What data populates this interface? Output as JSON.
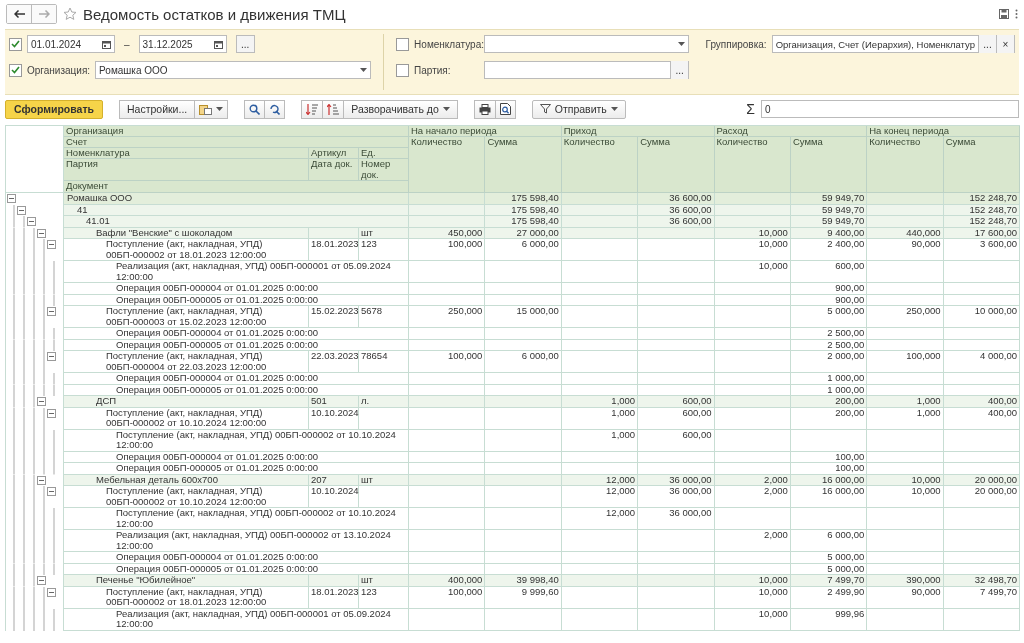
{
  "window": {
    "title": "Ведомость остатков и движения ТМЦ"
  },
  "filters": {
    "period": {
      "checked": true,
      "from": "01.01.2024",
      "separator": "–",
      "to": "31.12.2025",
      "more": "..."
    },
    "organization": {
      "checked": true,
      "label": "Организация:",
      "value": "Ромашка ООО"
    },
    "nomenclature": {
      "checked": false,
      "label": "Номенклатура:"
    },
    "batch": {
      "checked": false,
      "label": "Партия:",
      "more": "..."
    },
    "grouping": {
      "label": "Группировка:",
      "value": "Организация, Счет (Иерархия), Номенклатур",
      "more": "...",
      "clear": "×"
    }
  },
  "toolbar": {
    "generate": "Сформировать",
    "settings": "Настройки...",
    "expand": "Разворачивать до",
    "send": "Отправить",
    "sum_sign": "Σ",
    "sum_value": "0"
  },
  "table": {
    "dimension_headers": {
      "organization": "Организация",
      "account": "Счет",
      "nomenclature": "Номенклатура",
      "article": "Артикул",
      "unit": "Ед.",
      "batch": "Партия",
      "doc_date": "Дата док.",
      "doc_number": "Номер док.",
      "document": "Документ"
    },
    "groups": [
      {
        "title": "На начало периода",
        "columns": [
          "Количество",
          "Сумма"
        ]
      },
      {
        "title": "Приход",
        "columns": [
          "Количество",
          "Сумма"
        ]
      },
      {
        "title": "Расход",
        "columns": [
          "Количество",
          "Сумма"
        ]
      },
      {
        "title": "На конец периода",
        "columns": [
          "Количество",
          "Сумма"
        ]
      }
    ],
    "rows": [
      {
        "kind": "organization",
        "name": "Ромашка ООО",
        "expanded": true,
        "values": {
          "start_sum": "175 598,40",
          "in_sum": "36 600,00",
          "out_sum": "59 949,70",
          "end_sum": "152 248,70"
        },
        "children": [
          {
            "kind": "account",
            "name": "41",
            "expanded": true,
            "values": {
              "start_sum": "175 598,40",
              "in_sum": "36 600,00",
              "out_sum": "59 949,70",
              "end_sum": "152 248,70"
            },
            "children": [
              {
                "kind": "account",
                "name": "41.01",
                "expanded": true,
                "values": {
                  "start_sum": "175 598,40",
                  "in_sum": "36 600,00",
                  "out_sum": "59 949,70",
                  "end_sum": "152 248,70"
                },
                "children": [
                  {
                    "kind": "item",
                    "name": "Вафли \"Венские\" с шоколадом",
                    "unit": "шт",
                    "expanded": true,
                    "values": {
                      "start_qty": "450,000",
                      "start_sum": "27 000,00",
                      "out_qty": "10,000",
                      "out_sum": "9 400,00",
                      "end_qty": "440,000",
                      "end_sum": "17 600,00"
                    },
                    "children": [
                      {
                        "kind": "batch",
                        "name": "Поступление (акт, накладная, УПД) 00БП-000002 от 18.01.2023 12:00:00",
                        "doc_date": "18.01.2023",
                        "doc_number": "123",
                        "expanded": true,
                        "values": {
                          "start_qty": "100,000",
                          "start_sum": "6 000,00",
                          "out_qty": "10,000",
                          "out_sum": "2 400,00",
                          "end_qty": "90,000",
                          "end_sum": "3 600,00"
                        },
                        "children": [
                          {
                            "kind": "document",
                            "name": "Реализация (акт, накладная, УПД) 00БП-000001 от 05.09.2024 12:00:00",
                            "values": {
                              "out_qty": "10,000",
                              "out_sum": "600,00"
                            }
                          },
                          {
                            "kind": "document",
                            "name": "Операция 00БП-000004 от 01.01.2025 0:00:00",
                            "values": {
                              "out_sum": "900,00"
                            }
                          },
                          {
                            "kind": "document",
                            "name": "Операция 00БП-000005 от 01.01.2025 0:00:00",
                            "values": {
                              "out_sum": "900,00"
                            }
                          }
                        ]
                      },
                      {
                        "kind": "batch",
                        "name": "Поступление (акт, накладная, УПД) 00БП-000003 от 15.02.2023 12:00:00",
                        "doc_date": "15.02.2023",
                        "doc_number": "5678",
                        "expanded": true,
                        "values": {
                          "start_qty": "250,000",
                          "start_sum": "15 000,00",
                          "out_sum": "5 000,00",
                          "end_qty": "250,000",
                          "end_sum": "10 000,00"
                        },
                        "children": [
                          {
                            "kind": "document",
                            "name": "Операция 00БП-000004 от 01.01.2025 0:00:00",
                            "values": {
                              "out_sum": "2 500,00"
                            }
                          },
                          {
                            "kind": "document",
                            "name": "Операция 00БП-000005 от 01.01.2025 0:00:00",
                            "values": {
                              "out_sum": "2 500,00"
                            }
                          }
                        ]
                      },
                      {
                        "kind": "batch",
                        "name": "Поступление (акт, накладная, УПД) 00БП-000004 от 22.03.2023 12:00:00",
                        "doc_date": "22.03.2023",
                        "doc_number": "78654",
                        "expanded": true,
                        "values": {
                          "start_qty": "100,000",
                          "start_sum": "6 000,00",
                          "out_sum": "2 000,00",
                          "end_qty": "100,000",
                          "end_sum": "4 000,00"
                        },
                        "children": [
                          {
                            "kind": "document",
                            "name": "Операция 00БП-000004 от 01.01.2025 0:00:00",
                            "values": {
                              "out_sum": "1 000,00"
                            }
                          },
                          {
                            "kind": "document",
                            "name": "Операция 00БП-000005 от 01.01.2025 0:00:00",
                            "values": {
                              "out_sum": "1 000,00"
                            }
                          }
                        ]
                      }
                    ]
                  },
                  {
                    "kind": "item",
                    "name": "ДСП",
                    "article": "501",
                    "unit": "л.",
                    "expanded": true,
                    "values": {
                      "in_qty": "1,000",
                      "in_sum": "600,00",
                      "out_sum": "200,00",
                      "end_qty": "1,000",
                      "end_sum": "400,00"
                    },
                    "children": [
                      {
                        "kind": "batch",
                        "name": "Поступление (акт, накладная, УПД) 00БП-000002 от 10.10.2024 12:00:00",
                        "doc_date": "10.10.2024",
                        "expanded": true,
                        "values": {
                          "in_qty": "1,000",
                          "in_sum": "600,00",
                          "out_sum": "200,00",
                          "end_qty": "1,000",
                          "end_sum": "400,00"
                        },
                        "children": [
                          {
                            "kind": "document",
                            "name": "Поступление (акт, накладная, УПД) 00БП-000002 от 10.10.2024 12:00:00",
                            "values": {
                              "in_qty": "1,000",
                              "in_sum": "600,00"
                            }
                          },
                          {
                            "kind": "document",
                            "name": "Операция 00БП-000004 от 01.01.2025 0:00:00",
                            "values": {
                              "out_sum": "100,00"
                            }
                          },
                          {
                            "kind": "document",
                            "name": "Операция 00БП-000005 от 01.01.2025 0:00:00",
                            "values": {
                              "out_sum": "100,00"
                            }
                          }
                        ]
                      }
                    ]
                  },
                  {
                    "kind": "item",
                    "name": "Мебельная деталь 600х700",
                    "article": "207",
                    "unit": "шт",
                    "expanded": true,
                    "values": {
                      "in_qty": "12,000",
                      "in_sum": "36 000,00",
                      "out_qty": "2,000",
                      "out_sum": "16 000,00",
                      "end_qty": "10,000",
                      "end_sum": "20 000,00"
                    },
                    "children": [
                      {
                        "kind": "batch",
                        "name": "Поступление (акт, накладная, УПД) 00БП-000002 от 10.10.2024 12:00:00",
                        "doc_date": "10.10.2024",
                        "expanded": true,
                        "values": {
                          "in_qty": "12,000",
                          "in_sum": "36 000,00",
                          "out_qty": "2,000",
                          "out_sum": "16 000,00",
                          "end_qty": "10,000",
                          "end_sum": "20 000,00"
                        },
                        "children": [
                          {
                            "kind": "document",
                            "name": "Поступление (акт, накладная, УПД) 00БП-000002 от 10.10.2024 12:00:00",
                            "values": {
                              "in_qty": "12,000",
                              "in_sum": "36 000,00"
                            }
                          },
                          {
                            "kind": "document",
                            "name": "Реализация (акт, накладная, УПД) 00БП-000002 от 13.10.2024 12:00:00",
                            "values": {
                              "out_qty": "2,000",
                              "out_sum": "6 000,00"
                            }
                          },
                          {
                            "kind": "document",
                            "name": "Операция 00БП-000004 от 01.01.2025 0:00:00",
                            "values": {
                              "out_sum": "5 000,00"
                            }
                          },
                          {
                            "kind": "document",
                            "name": "Операция 00БП-000005 от 01.01.2025 0:00:00",
                            "values": {
                              "out_sum": "5 000,00"
                            }
                          }
                        ]
                      }
                    ]
                  },
                  {
                    "kind": "item",
                    "name": "Печенье \"Юбилейное\"",
                    "unit": "шт",
                    "expanded": true,
                    "values": {
                      "start_qty": "400,000",
                      "start_sum": "39 998,40",
                      "out_qty": "10,000",
                      "out_sum": "7 499,70",
                      "end_qty": "390,000",
                      "end_sum": "32 498,70"
                    },
                    "children": [
                      {
                        "kind": "batch",
                        "name": "Поступление (акт, накладная, УПД) 00БП-000002 от 18.01.2023 12:00:00",
                        "doc_date": "18.01.2023",
                        "doc_number": "123",
                        "expanded": true,
                        "values": {
                          "start_qty": "100,000",
                          "start_sum": "9 999,60",
                          "out_qty": "10,000",
                          "out_sum": "2 499,90",
                          "end_qty": "90,000",
                          "end_sum": "7 499,70"
                        },
                        "children": [
                          {
                            "kind": "document",
                            "name": "Реализация (акт, накладная, УПД) 00БП-000001 от 05.09.2024 12:00:00",
                            "values": {
                              "out_qty": "10,000",
                              "out_sum": "999,96"
                            }
                          }
                        ]
                      }
                    ]
                  }
                ]
              }
            ]
          }
        ]
      }
    ]
  }
}
